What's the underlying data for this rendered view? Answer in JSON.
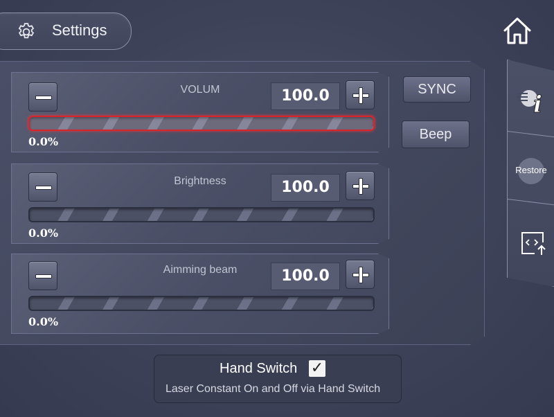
{
  "header": {
    "title": "Settings",
    "gear_icon": "gear-icon",
    "home_icon": "home-icon"
  },
  "controls": [
    {
      "label": "VOLUM",
      "value": "100.0",
      "percent": "0.0%",
      "active": true
    },
    {
      "label": "Brightness",
      "value": "100.0",
      "percent": "0.0%",
      "active": false
    },
    {
      "label": "Aimming beam",
      "value": "100.0",
      "percent": "0.0%",
      "active": false
    }
  ],
  "buttons": {
    "sync": "SYNC",
    "beep": "Beep"
  },
  "sidebar": {
    "info_icon": "info-icon",
    "restore": "Restore",
    "export_icon": "export-icon"
  },
  "hand_switch": {
    "title": "Hand Switch",
    "checked": true,
    "check_mark": "✓",
    "description": "Laser Constant On  and Off via Hand Switch"
  },
  "colors": {
    "active_bar": "#d8252b",
    "background": "#3e4258"
  }
}
